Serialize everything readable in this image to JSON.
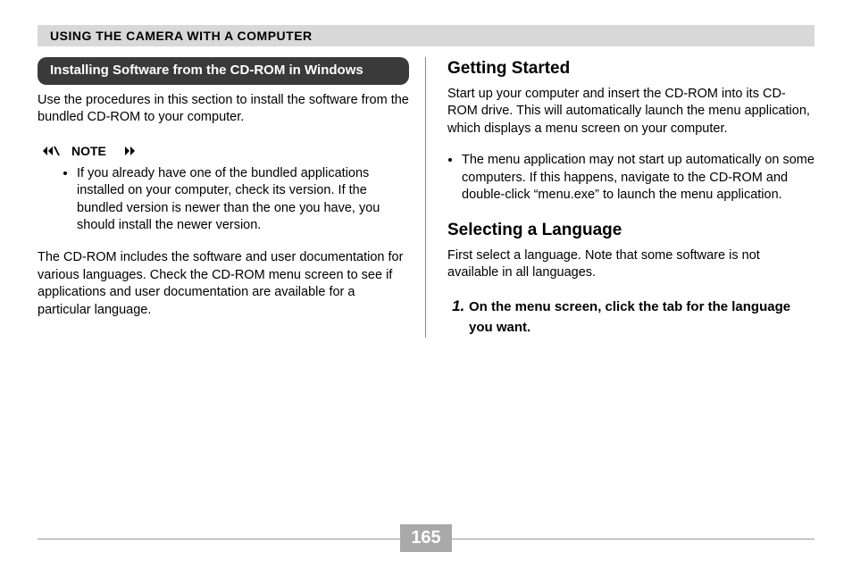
{
  "header": "USING THE CAMERA WITH A COMPUTER",
  "left": {
    "sectionTitle": "Installing Software from the CD-ROM in Windows",
    "intro": "Use the procedures in this section to install the software from the bundled CD-ROM to your computer.",
    "noteLabel": "NOTE",
    "noteItems": [
      "If you already have one of the bundled applications installed on your computer, check its version. If the bundled version is newer than the one you have, you should install the newer version."
    ],
    "para2": "The CD-ROM includes the software and user documentation for various languages. Check the CD-ROM menu screen to see if applications and user documentation are available for a particular language."
  },
  "right": {
    "h1": "Getting Started",
    "p1": "Start up your computer and insert the CD-ROM into its CD-ROM drive. This will automatically launch the menu application, which displays a menu screen on your computer.",
    "bullets1": [
      "The menu application may not start up automatically on some computers. If this happens, navigate to the CD-ROM and double-click “menu.exe” to launch the menu application."
    ],
    "h2": "Selecting a Language",
    "p2": "First select a language. Note that some software is not available in all languages.",
    "steps": [
      "On the menu screen, click the tab for the language you want."
    ]
  },
  "pageNumber": "165"
}
